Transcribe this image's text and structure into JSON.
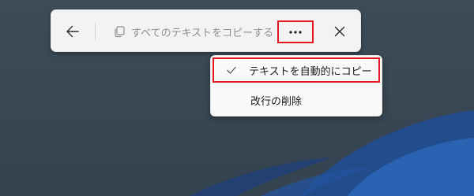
{
  "toolbar": {
    "back_icon": "arrow-left-icon",
    "copy_all_icon": "copy-icon",
    "copy_all_label": "すべてのテキストをコピーする",
    "more_icon": "ellipsis-icon",
    "more_label": "···",
    "close_icon": "close-icon"
  },
  "menu": {
    "items": [
      {
        "label": "テキストを自動的にコピー",
        "checked": true,
        "icon": "checkmark-icon"
      },
      {
        "label": "改行の削除",
        "checked": false
      }
    ]
  },
  "colors": {
    "highlight": "#e0171f",
    "desktop": "#3a4a58",
    "toolbar_bg": "#f3f3f3",
    "disabled_text": "#8e8e8e"
  }
}
